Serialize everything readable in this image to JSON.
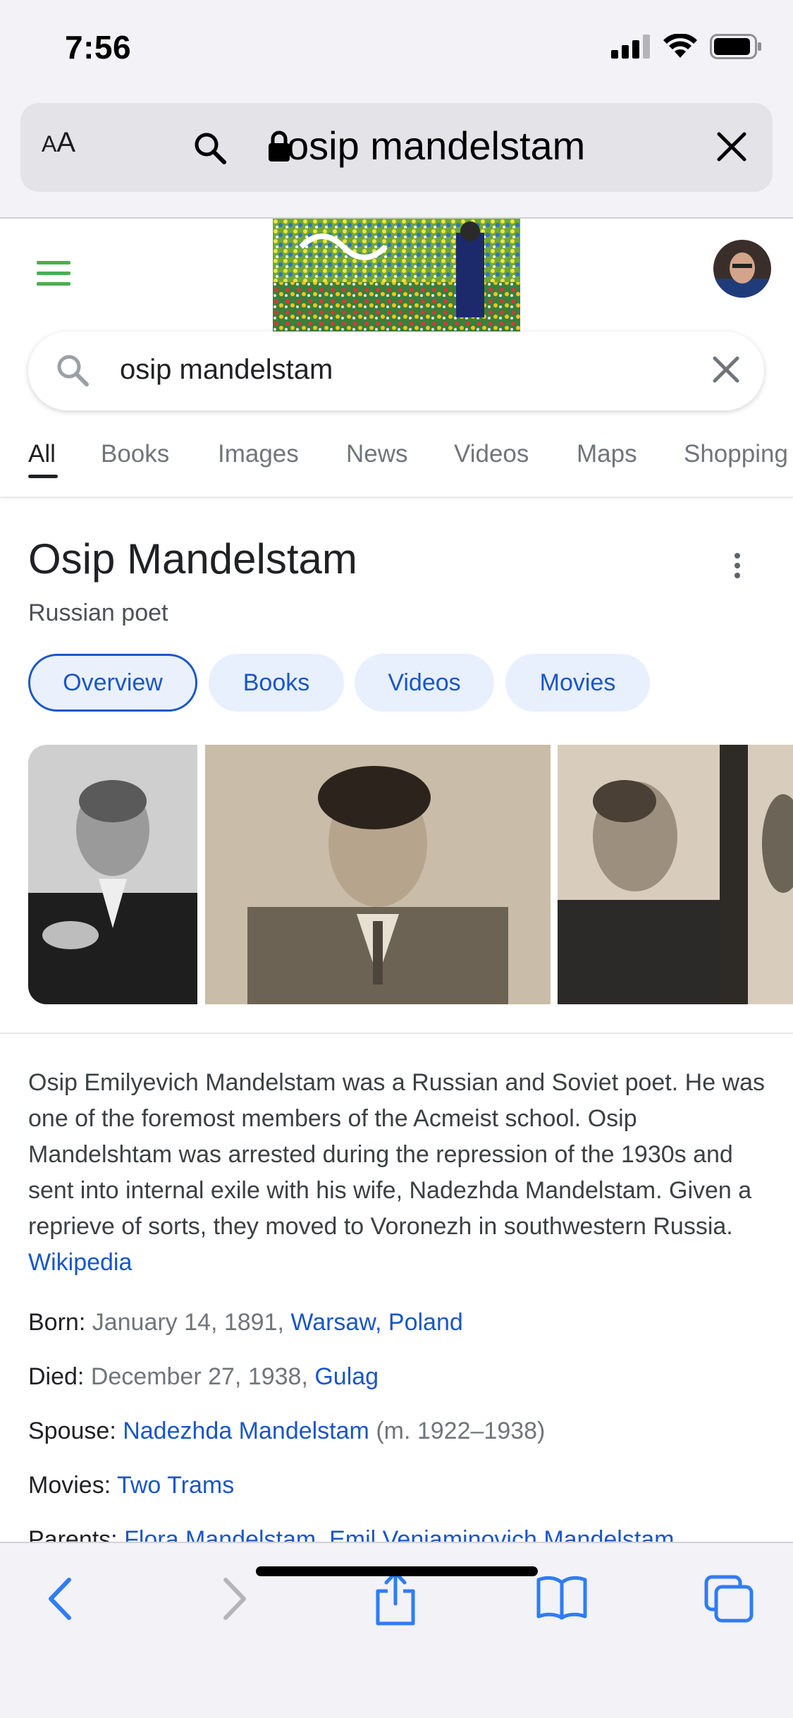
{
  "status_bar": {
    "time": "7:56"
  },
  "safari": {
    "text_size_label_small": "A",
    "text_size_label_large": "A",
    "address_text": "osip mandelstam"
  },
  "google": {
    "search_query": "osip mandelstam",
    "tabs": [
      {
        "label": "All",
        "active": true
      },
      {
        "label": "Books"
      },
      {
        "label": "Images"
      },
      {
        "label": "News"
      },
      {
        "label": "Videos"
      },
      {
        "label": "Maps"
      },
      {
        "label": "Shopping"
      }
    ]
  },
  "knowledge_panel": {
    "title": "Osip Mandelstam",
    "subtitle": "Russian poet",
    "chips": [
      "Overview",
      "Books",
      "Videos",
      "Movies"
    ],
    "description": "Osip Emilyevich Mandelstam was a Russian and Soviet poet. He was one of the foremost members of the Acmeist school. Osip Mandelshtam was arrested during the repression of the 1930s and sent into internal exile with his wife, Nadezhda Mandelstam. Given a reprieve of sorts, they moved to Voronezh in southwestern Russia.",
    "description_source": "Wikipedia",
    "facts": {
      "born_label": "Born:",
      "born_value": "January 14, 1891,",
      "born_link": "Warsaw, Poland",
      "died_label": "Died:",
      "died_value": "December 27, 1938,",
      "died_link": "Gulag",
      "spouse_label": "Spouse:",
      "spouse_link": "Nadezhda Mandelstam",
      "spouse_value": "(m. 1922–1938)",
      "movies_label": "Movies:",
      "movies_link": "Two Trams",
      "parents_label": "Parents:",
      "parents_link_1": "Flora Mandelstam,",
      "parents_link_2": "Emil Veniaminovich Mandelstam"
    }
  },
  "colors": {
    "link_blue": "#1a56c8",
    "chip_bg": "#e8f0fe",
    "ios_gray_bg": "#f2f2f7",
    "ios_blue": "#2f7cf6",
    "hamburger_green": "#4caf50"
  },
  "icons": [
    "signal-icon",
    "wifi-icon",
    "battery-icon",
    "search-icon",
    "lock-icon",
    "close-icon",
    "hamburger-menu-icon",
    "more-vert-icon",
    "back-arrow-icon",
    "forward-arrow-icon",
    "share-icon",
    "bookmarks-icon",
    "tabs-icon"
  ]
}
